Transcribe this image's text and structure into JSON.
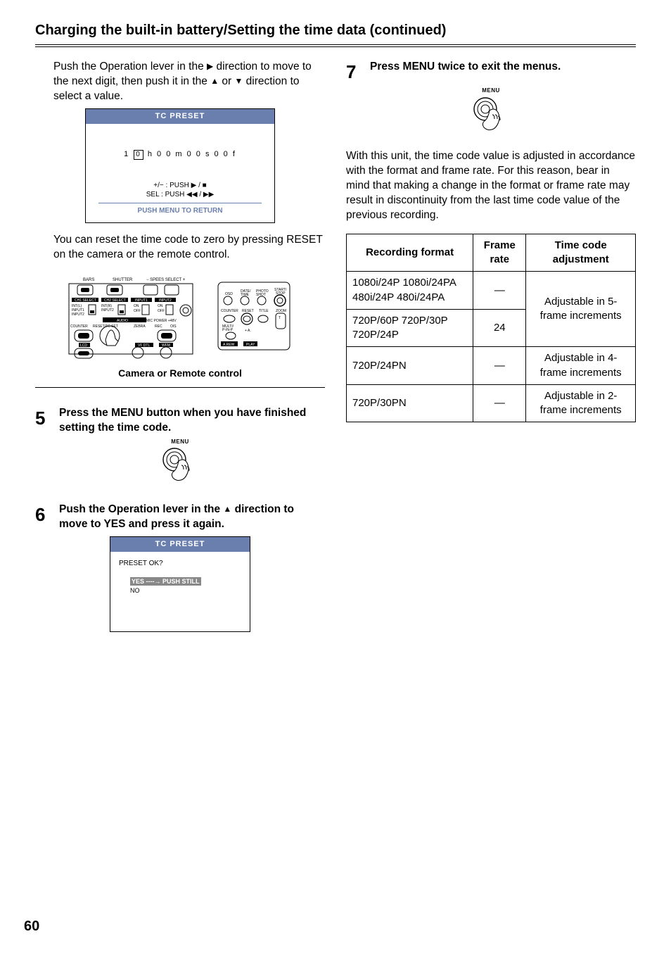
{
  "page": {
    "title": "Charging the built-in battery/Setting the time data (continued)",
    "number": "60"
  },
  "left": {
    "intro_a": "Push the Operation lever in the ",
    "intro_b": " direction to move to the next digit, then push it in the ",
    "intro_c": " or ",
    "intro_d": " direction to select a value.",
    "lcd1": {
      "header": "TC PRESET",
      "value_prefix": "1 ",
      "value_boxed": "0",
      "value_suffix": " h 0 0 m 0 0 s 0 0 f",
      "hint1": "+/− : PUSH ▶ / ■",
      "hint2": "SEL : PUSH ◀◀ / ▶▶",
      "footer": "PUSH  MENU TO RETURN"
    },
    "reset_text": "You can reset the time code to zero by pressing RESET on the camera or the remote control.",
    "caption": "Camera or Remote control",
    "step5_num": "5",
    "step5_text": "Press the MENU button when you have finished setting the time code.",
    "menu_label": "MENU",
    "step6_num": "6",
    "step6_text_a": "Push the Operation lever in the ",
    "step6_text_b": " direction to move to YES and press it again.",
    "lcd2": {
      "header": "TC PRESET",
      "question": "PRESET OK?",
      "yes": "YES ----→ PUSH STILL",
      "no": "NO"
    }
  },
  "right": {
    "step7_num": "7",
    "step7_text": "Press MENU twice to exit the menus.",
    "menu_label": "MENU",
    "paragraph": "With this unit, the time code value is adjusted in accordance with the format and frame rate. For this reason, bear in mind that making a change in the format or frame rate may result in discontinuity from the last time code value of the previous recording.",
    "table": {
      "h1": "Recording format",
      "h2": "Frame rate",
      "h3": "Time code adjustment",
      "r1c1": "1080i/24P 1080i/24PA 480i/24P 480i/24PA",
      "r1c2": "—",
      "r2c1": "720P/60P 720P/30P 720P/24P",
      "r2c2": "24",
      "r12c3": "Adjustable in 5-frame increments",
      "r3c1": "720P/24PN",
      "r3c2": "—",
      "r3c3": "Adjustable in 4-frame increments",
      "r4c1": "720P/30PN",
      "r4c2": "—",
      "r4c3": "Adjustable in 2-frame increments"
    }
  }
}
